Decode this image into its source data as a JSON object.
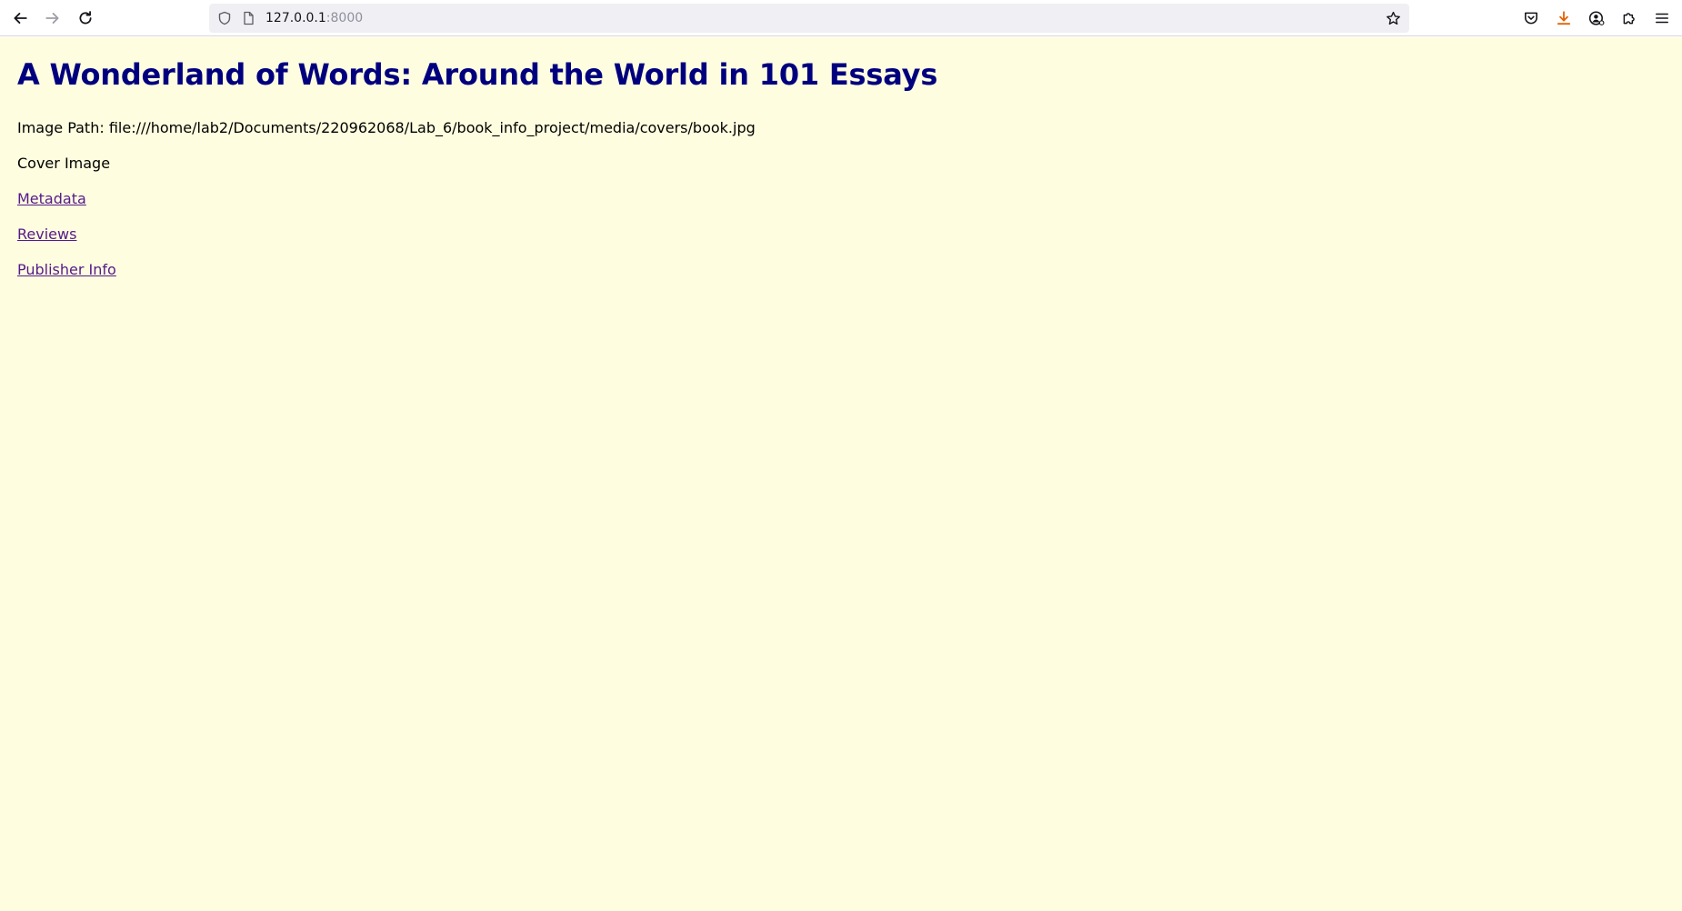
{
  "browser": {
    "url_host": "127.0.0.1",
    "url_port": ":8000"
  },
  "page": {
    "title": "A Wonderland of Words: Around the World in 101 Essays",
    "image_path_label": "Image Path: file:///home/lab2/Documents/220962068/Lab_6/book_info_project/media/covers/book.jpg",
    "cover_image_alt": "Cover Image",
    "links": {
      "metadata": "Metadata",
      "reviews": "Reviews",
      "publisher_info": "Publisher Info"
    }
  },
  "colors": {
    "page_background": "#fefddf",
    "title": "#00007f",
    "visited_link": "#551a8b",
    "download_accent": "#e66000"
  },
  "icons": {
    "back": "arrow-left-icon",
    "forward": "arrow-right-icon",
    "reload": "reload-icon",
    "shield": "shield-icon",
    "page": "page-icon",
    "star": "star-icon",
    "pocket": "pocket-icon",
    "download": "download-icon",
    "account": "account-icon",
    "extensions": "puzzle-icon",
    "menu": "hamburger-menu-icon"
  }
}
